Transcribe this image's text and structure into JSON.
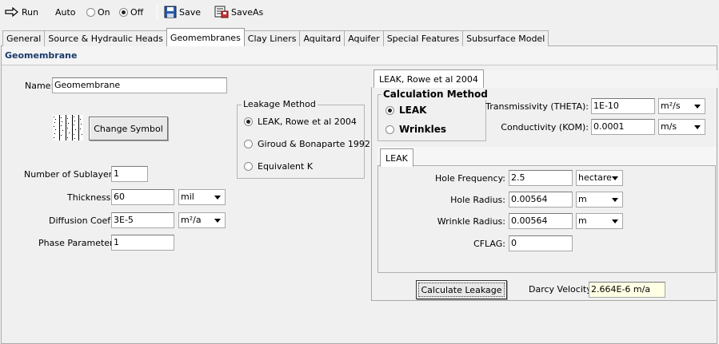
{
  "toolbar": {
    "run_label": "Run",
    "auto_label": "Auto",
    "on_label": "On",
    "off_label": "Off",
    "save_label": "Save",
    "saveas_label": "SaveAs"
  },
  "tabs": [
    {
      "label": "General"
    },
    {
      "label": "Source & Hydraulic Heads"
    },
    {
      "label": "Geomembranes"
    },
    {
      "label": "Clay Liners"
    },
    {
      "label": "Aquitard"
    },
    {
      "label": "Aquifer"
    },
    {
      "label": "Special Features"
    },
    {
      "label": "Subsurface Model"
    }
  ],
  "header": {
    "title": "Geomembrane"
  },
  "left": {
    "name_label": "Name:",
    "name_value": "Geomembrane",
    "change_symbol_label": "Change Symbol",
    "sublayers_label": "Number of Sublayers:",
    "sublayers_value": "1",
    "thickness_label": "Thickness:",
    "thickness_value": "60",
    "thickness_unit": "mil",
    "diffusion_label": "Diffusion Coef:",
    "diffusion_value": "3E-5",
    "diffusion_unit": "m²/a",
    "phase_label": "Phase Parameter:",
    "phase_value": "1"
  },
  "leakage": {
    "title": "Leakage Method",
    "options": [
      "LEAK, Rowe et al 2004",
      "Giroud & Bonaparte 1992",
      "Equivalent K"
    ],
    "selected": 0
  },
  "right": {
    "tab_label": "LEAK, Rowe et al 2004",
    "calc_method_title": "Calculation Method",
    "calc_options": [
      "LEAK",
      "Wrinkles"
    ],
    "calc_selected": 0,
    "transmissivity_label": "Transmissivity (THETA):",
    "transmissivity_value": "1E-10",
    "transmissivity_unit": "m²/s",
    "conductivity_label": "Conductivity (KOM):",
    "conductivity_value": "0.0001",
    "conductivity_unit": "m/s",
    "subtab_label": "LEAK",
    "hole_freq_label": "Hole Frequency:",
    "hole_freq_value": "2.5",
    "hole_freq_unit": "hectare",
    "hole_radius_label": "Hole Radius:",
    "hole_radius_value": "0.00564",
    "hole_radius_unit": "m",
    "wrinkle_radius_label": "Wrinkle Radius:",
    "wrinkle_radius_value": "0.00564",
    "wrinkle_radius_unit": "m",
    "cflag_label": "CFLAG:",
    "cflag_value": "0",
    "calc_button_label": "Calculate Leakage",
    "darcy_label": "Darcy Velocity",
    "darcy_value": "2.664E-6 m/a"
  }
}
